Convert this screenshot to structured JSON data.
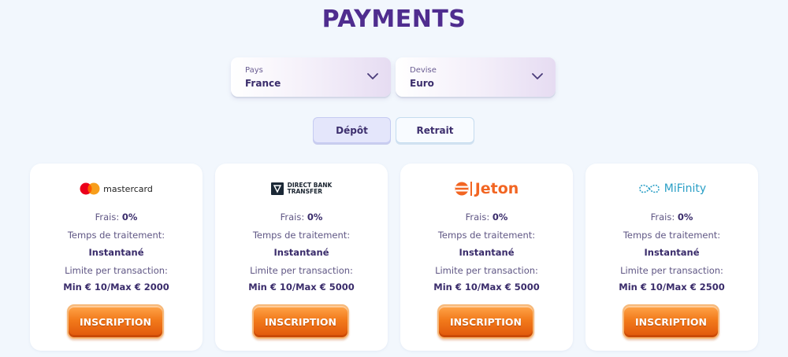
{
  "title": "PAYMENTS",
  "filters": {
    "country": {
      "label": "Pays",
      "value": "France"
    },
    "currency": {
      "label": "Devise",
      "value": "Euro"
    }
  },
  "tabs": {
    "deposit": "Dépôt",
    "withdraw": "Retrait"
  },
  "colors": {
    "title": "#4f2d8f",
    "button": "#f27a1b",
    "background": "#f2f7fd"
  },
  "cards": [
    {
      "logo": "mastercard",
      "logo_icon": "mastercard-icon",
      "fee_label": "Frais:",
      "fee_value": "0%",
      "time_label": "Temps de traitement:",
      "time_value": "Instantané",
      "limit_label": "Limite per transaction:",
      "limit_value": "Min € 10/Max € 2000",
      "button": "INSCRIPTION"
    },
    {
      "logo": "DIRECT BANK TRANSFER",
      "logo_line1": "DIRECT BANK",
      "logo_line2": "TRANSFER",
      "logo_icon": "bank-transfer-icon",
      "fee_label": "Frais:",
      "fee_value": "0%",
      "time_label": "Temps de traitement:",
      "time_value": "Instantané",
      "limit_label": "Limite per transaction:",
      "limit_value": "Min € 10/Max € 5000",
      "button": "INSCRIPTION"
    },
    {
      "logo": "Jeton",
      "logo_icon": "jeton-icon",
      "fee_label": "Frais:",
      "fee_value": "0%",
      "time_label": "Temps de traitement:",
      "time_value": "Instantané",
      "limit_label": "Limite per transaction:",
      "limit_value": "Min € 10/Max € 5000",
      "button": "INSCRIPTION"
    },
    {
      "logo": "MiFinity",
      "logo_icon": "mifinity-icon",
      "fee_label": "Frais:",
      "fee_value": "0%",
      "time_label": "Temps de traitement:",
      "time_value": "Instantané",
      "limit_label": "Limite per transaction:",
      "limit_value": "Min € 10/Max € 2500",
      "button": "INSCRIPTION"
    }
  ]
}
